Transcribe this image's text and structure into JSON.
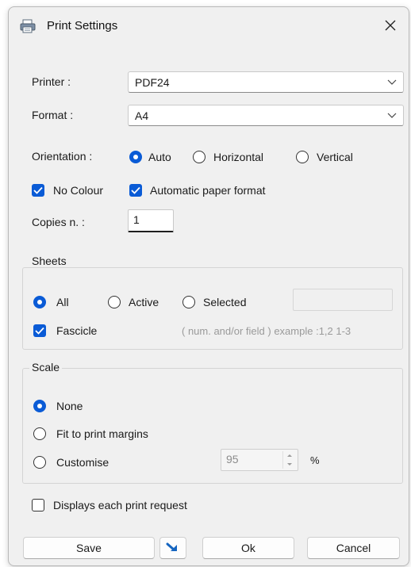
{
  "window": {
    "title": "Print Settings"
  },
  "printer": {
    "label": "Printer :",
    "value": "PDF24"
  },
  "format": {
    "label": "Format :",
    "value": "A4"
  },
  "orientation": {
    "label": "Orientation :",
    "options": [
      "Auto",
      "Horizontal",
      "Vertical"
    ],
    "selected": "Auto"
  },
  "options": {
    "no_colour": {
      "label": "No Colour",
      "checked": true
    },
    "auto_paper": {
      "label": "Automatic paper format",
      "checked": true
    }
  },
  "copies": {
    "label": "Copies n. :",
    "value": "1"
  },
  "sheets": {
    "title": "Sheets",
    "options": [
      "All",
      "Active",
      "Selected"
    ],
    "selected": "All",
    "fascicle": {
      "label": "Fascicle",
      "checked": true
    },
    "hint": "( num. and/or field ) example :1,2 1-3"
  },
  "scale": {
    "title": "Scale",
    "options": [
      "None",
      "Fit to print margins",
      "Customise"
    ],
    "selected": "None",
    "custom_value": "95",
    "unit": "%"
  },
  "display_each": {
    "label": "Displays each print request",
    "checked": false
  },
  "buttons": {
    "save": "Save",
    "ok": "Ok",
    "cancel": "Cancel"
  },
  "colors": {
    "accent": "#0a5bd6",
    "window_bg": "#f0f0f0"
  },
  "icons": {
    "title": "printer-icon",
    "close": "close-icon",
    "save_menu": "arrow-down-right-icon"
  }
}
